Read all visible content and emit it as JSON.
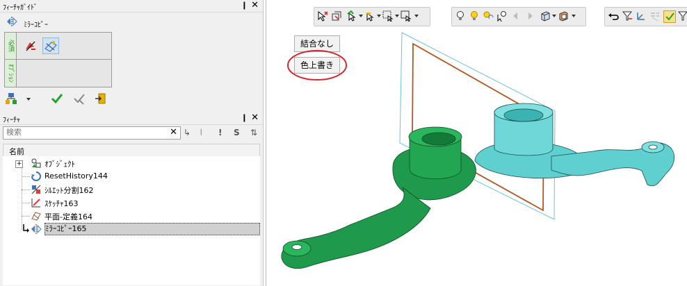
{
  "feature_guide": {
    "title": "ﾌｨｰﾁｬｶﾞｲﾄﾞ",
    "pin": "❙",
    "close": "✕",
    "command_name": "ﾐﾗｰｺﾋﾟｰ",
    "tab_required": "必須",
    "tab_option": "ｵﾌﾟｼｮﾝ"
  },
  "feature_tree": {
    "title": "ﾌｨｰﾁｬ",
    "pin": "❙",
    "close": "✕",
    "search_placeholder": "検索",
    "search_clear": "✕",
    "filter_s": "S",
    "column_header": "名前",
    "expander": "+",
    "items": [
      {
        "label": "ｵﾌﾞｼﾞｪｸﾄ"
      },
      {
        "label": "ResetHistory144"
      },
      {
        "label": "ｼﾙｴｯﾄ分割162"
      },
      {
        "label": "ｽｹｯﾁｬ163"
      },
      {
        "label": "平面-定義164"
      },
      {
        "label": "ﾐﾗｰｺﾋﾟｰ165"
      }
    ]
  },
  "viewport": {
    "button_combine_none": "結合なし",
    "button_color_overwrite": "色上書き"
  },
  "colors": {
    "green_part": "#1f9a4c",
    "cyan_part": "#63d2d2",
    "plane_frame": "#b5551f",
    "highlight_circle": "#d9262c"
  }
}
